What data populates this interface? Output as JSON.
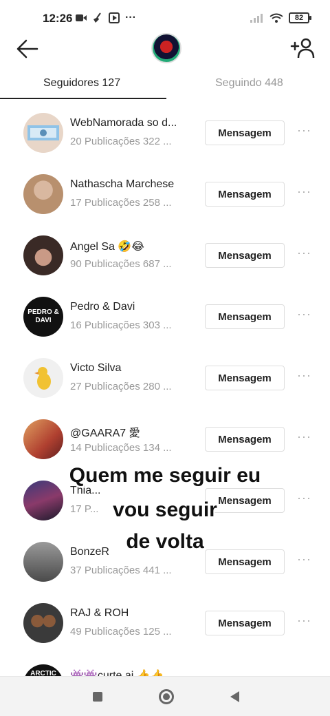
{
  "status_bar": {
    "time": "12:26",
    "battery": "82"
  },
  "tabs": [
    {
      "label": "Seguidores 127",
      "active": true
    },
    {
      "label": "Seguindo 448",
      "active": false
    }
  ],
  "message_label": "Mensagem",
  "followers": [
    {
      "name": "WebNamorada so d...",
      "meta": "20 Publicações 322 ..."
    },
    {
      "name": "Nathascha Marchese",
      "meta": "17 Publicações 258 ..."
    },
    {
      "name": "Angel Sa 🤣😂",
      "meta": "90 Publicações 687 ..."
    },
    {
      "name": "Pedro & Davi",
      "meta": "16 Publicações 303 ..."
    },
    {
      "name": "Victo Silva",
      "meta": "27 Publicações 280 ..."
    },
    {
      "name": "@GAARA7 愛",
      "meta": "14 Publicações 134 ..."
    },
    {
      "name": "Thia...",
      "meta": "17 P..."
    },
    {
      "name": "BonzeR",
      "meta": "37 Publicações 441 ..."
    },
    {
      "name": "RAJ & ROH",
      "meta": "49 Publicações 125 ..."
    },
    {
      "name": "👾👾curte ai 👍👍",
      "meta": ""
    }
  ],
  "overlay": {
    "line1": "Quem me seguir eu",
    "line2": "vou seguir",
    "line3": "de volta"
  },
  "avatar_texts": {
    "pedro_davi": "PEDRO & DAVI",
    "arctic": "ARCTIC"
  },
  "colors": {
    "text": "#222222",
    "muted": "#999999",
    "button_border": "#dddddd"
  }
}
